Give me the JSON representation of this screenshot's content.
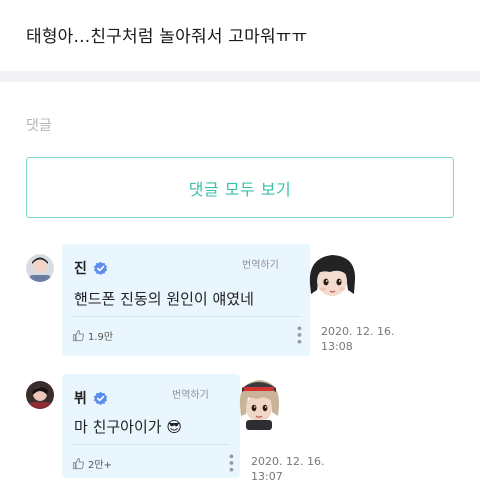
{
  "post": {
    "title": "태형아...친구처럼 놀아줘서 고마워ㅠㅠ"
  },
  "comments_section": {
    "label": "댓글",
    "view_all_label": "댓글 모두 보기"
  },
  "comments": [
    {
      "name": "진",
      "translate_label": "번역하기",
      "text": "핸드폰 진동의 원인이 얘였네",
      "likes": "1.9만",
      "date_line1": "2020. 12. 16.",
      "date_line2": "13:08"
    },
    {
      "name": "뷔",
      "translate_label": "번역하기",
      "text": "마 친구아이가",
      "emoji": "😎",
      "likes": "2만+",
      "date_line1": "2020. 12. 16.",
      "date_line2": "13:07"
    }
  ],
  "colors": {
    "accent": "#3cc0aa",
    "verified": "#5b8def",
    "bubble": "#eaf6fd"
  },
  "icons": [
    "verified-badge-icon",
    "thumb-up-icon",
    "more-options-icon"
  ]
}
